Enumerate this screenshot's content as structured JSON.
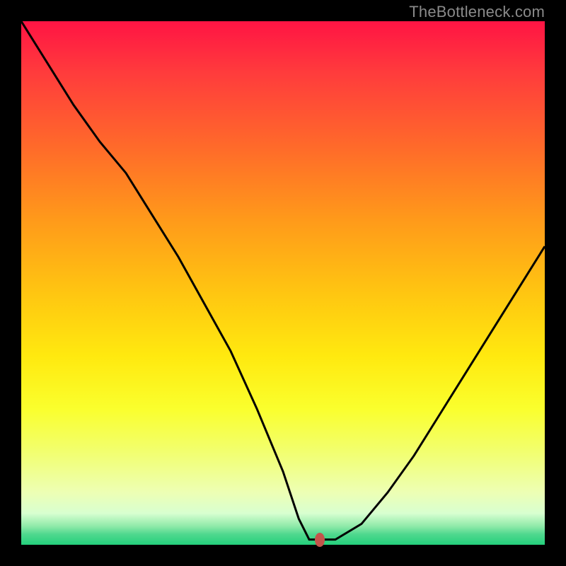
{
  "attribution": "TheBottleneck.com",
  "chart_data": {
    "type": "line",
    "xlabel": "",
    "ylabel": "",
    "xlim": [
      0,
      100
    ],
    "ylim": [
      0,
      100
    ],
    "series": [
      {
        "name": "bottleneck-curve",
        "x": [
          0,
          5,
          10,
          15,
          20,
          25,
          30,
          35,
          40,
          45,
          50,
          53,
          55,
          57,
          60,
          65,
          70,
          75,
          80,
          85,
          90,
          95,
          100
        ],
        "values": [
          100,
          92,
          84,
          77,
          71,
          63,
          55,
          46,
          37,
          26,
          14,
          5,
          1,
          1,
          1,
          4,
          10,
          17,
          25,
          33,
          41,
          49,
          57
        ]
      }
    ],
    "marker": {
      "x": 57,
      "y": 1
    }
  },
  "colors": {
    "curve": "#000000",
    "marker": "#c4544b"
  }
}
